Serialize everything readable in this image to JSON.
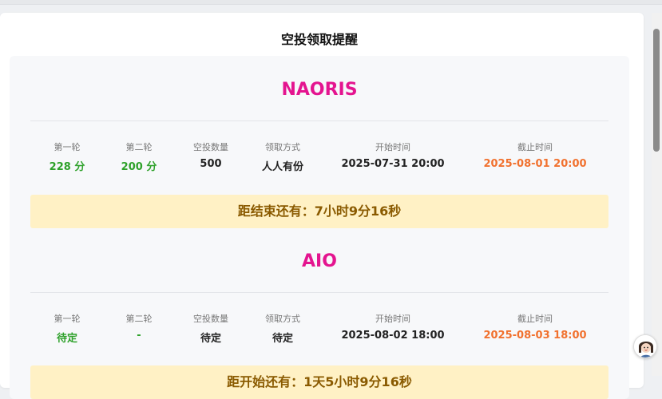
{
  "page": {
    "title": "空投领取提醒"
  },
  "labels": {
    "round1": "第一轮",
    "round2": "第二轮",
    "quantity": "空投数量",
    "method": "领取方式",
    "start": "开始时间",
    "end": "截止时间"
  },
  "projects": [
    {
      "name": "NAORIS",
      "round1": "228 分",
      "round2": "200 分",
      "quantity": "500",
      "method": "人人有份",
      "start": "2025-07-31 20:00",
      "end": "2025-08-01 20:00",
      "countdown": "距结束还有：7小时9分16秒"
    },
    {
      "name": "AIO",
      "round1": "待定",
      "round2": "-",
      "quantity": "待定",
      "method": "待定",
      "start": "2025-08-02 18:00",
      "end": "2025-08-03 18:00",
      "countdown": "距开始还有：1天5小时9分16秒"
    }
  ],
  "colors": {
    "project_name": "#e4148f",
    "round_value": "#2ea12a",
    "end_time": "#f1712e",
    "countdown_bg": "#fff1c5",
    "countdown_text": "#8a5a00"
  },
  "icons": {
    "assistant": "avatar-icon"
  }
}
